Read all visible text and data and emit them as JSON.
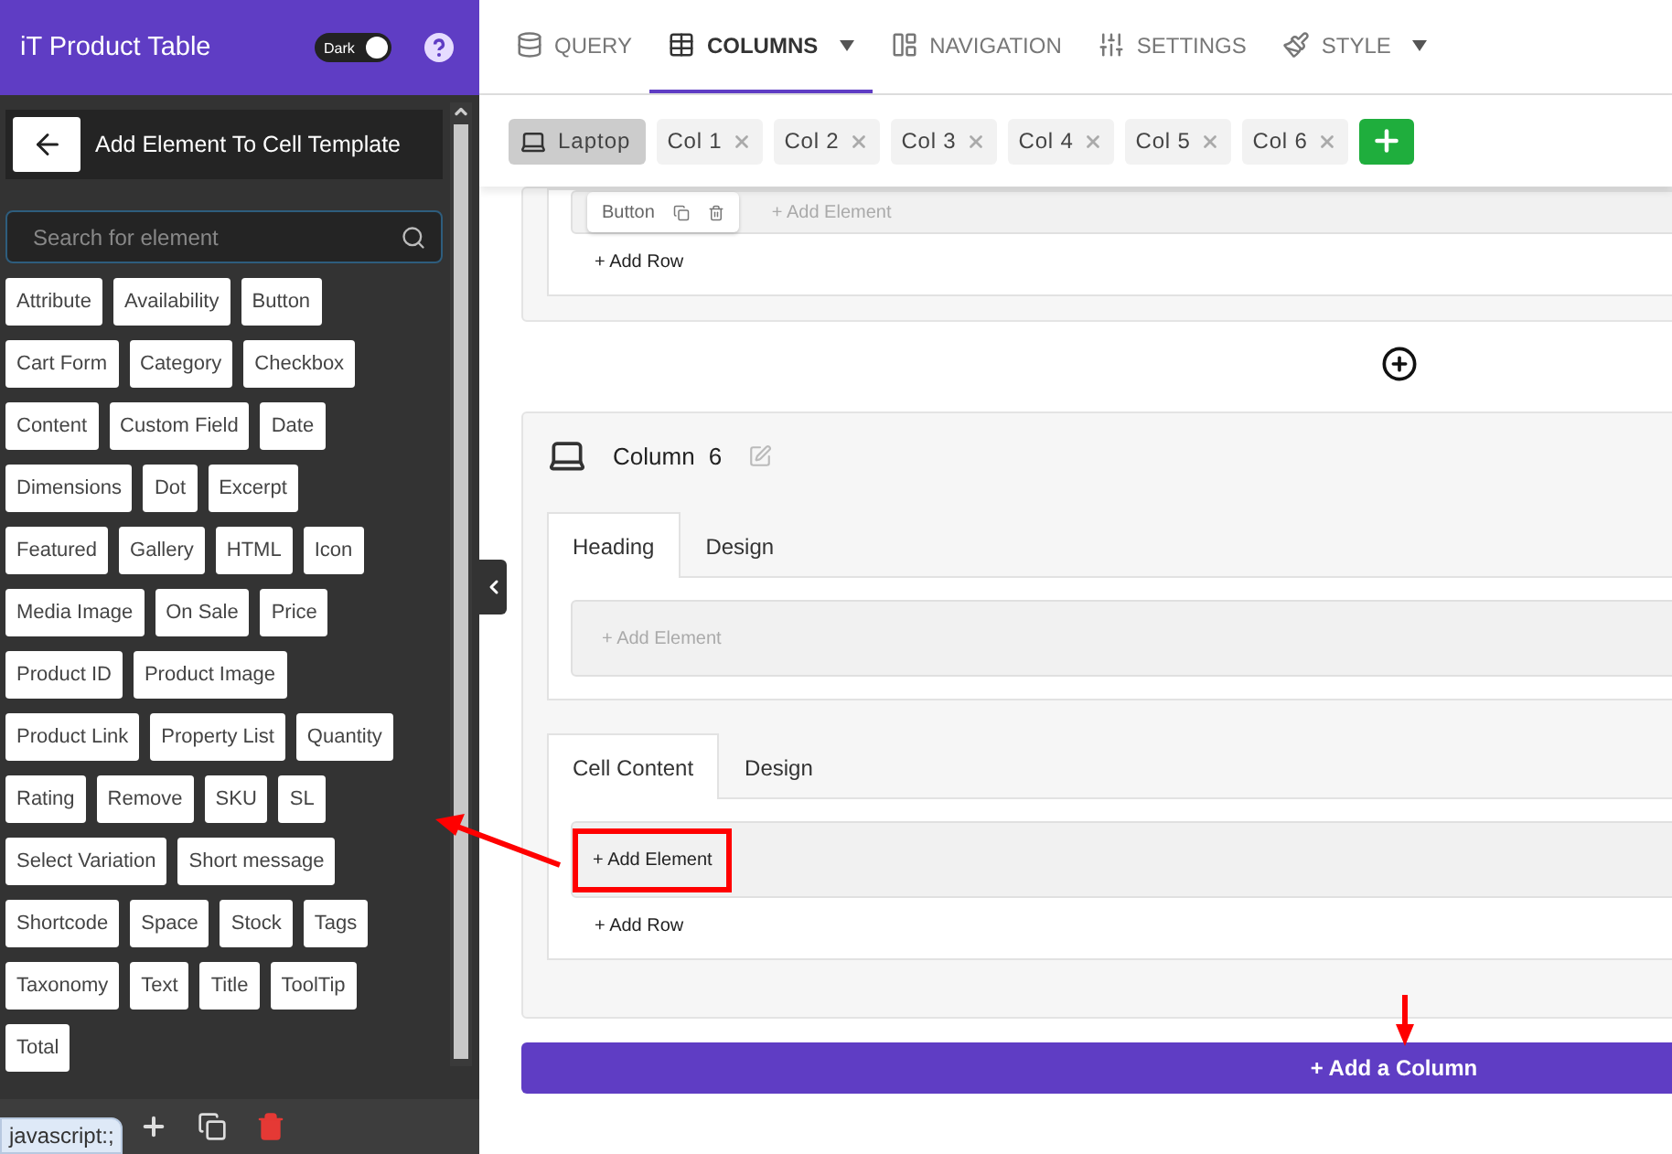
{
  "sidebar": {
    "title": "iT Product Table",
    "dark_toggle": {
      "label": "Dark",
      "on": true
    },
    "panel_title": "Add Element To Cell Template",
    "search": {
      "placeholder": "Search for element"
    },
    "element_rows": [
      [
        "Attribute",
        "Availability",
        "Button"
      ],
      [
        "Cart Form",
        "Category",
        "Checkbox"
      ],
      [
        "Content",
        "Custom Field",
        "Date"
      ],
      [
        "Dimensions",
        "Dot",
        "Excerpt"
      ],
      [
        "Featured",
        "Gallery",
        "HTML",
        "Icon"
      ],
      [
        "Media Image",
        "On Sale",
        "Price"
      ],
      [
        "Product ID",
        "Product Image"
      ],
      [
        "Product Link",
        "Property List",
        "Quantity"
      ],
      [
        "Rating",
        "Remove",
        "SKU",
        "SL"
      ],
      [
        "Select Variation",
        "Short message"
      ],
      [
        "Shortcode",
        "Space",
        "Stock",
        "Tags"
      ],
      [
        "Taxonomy",
        "Text",
        "Title",
        "ToolTip"
      ],
      [
        "Total"
      ]
    ]
  },
  "nav_tabs": [
    {
      "label": "QUERY",
      "selected": false,
      "dropdown": false
    },
    {
      "label": "COLUMNS",
      "selected": true,
      "dropdown": true
    },
    {
      "label": "NAVIGATION",
      "selected": false,
      "dropdown": false
    },
    {
      "label": "SETTINGS",
      "selected": false,
      "dropdown": false
    },
    {
      "label": "STYLE",
      "selected": false,
      "dropdown": true
    }
  ],
  "column_bar": {
    "device": "Laptop",
    "columns": [
      "Col 1",
      "Col 2",
      "Col 3",
      "Col 4",
      "Col 5",
      "Col 6"
    ]
  },
  "previous_column": {
    "element": "Button",
    "add_element": "+ Add Element",
    "add_row": "+ Add Row"
  },
  "column": {
    "title": "Column",
    "number": "6",
    "sections": [
      {
        "tabs": [
          {
            "label": "Heading",
            "selected": true
          },
          {
            "label": "Design",
            "selected": false
          }
        ],
        "add_element": "+ Add Element",
        "highlighted": false
      },
      {
        "tabs": [
          {
            "label": "Cell Content",
            "selected": true
          },
          {
            "label": "Design",
            "selected": false
          }
        ],
        "add_element": "+ Add Element",
        "highlighted": true,
        "add_row": "+ Add Row"
      }
    ]
  },
  "add_column_button": "+ Add a Column",
  "status_bar": {
    "link": "javascript:;"
  }
}
